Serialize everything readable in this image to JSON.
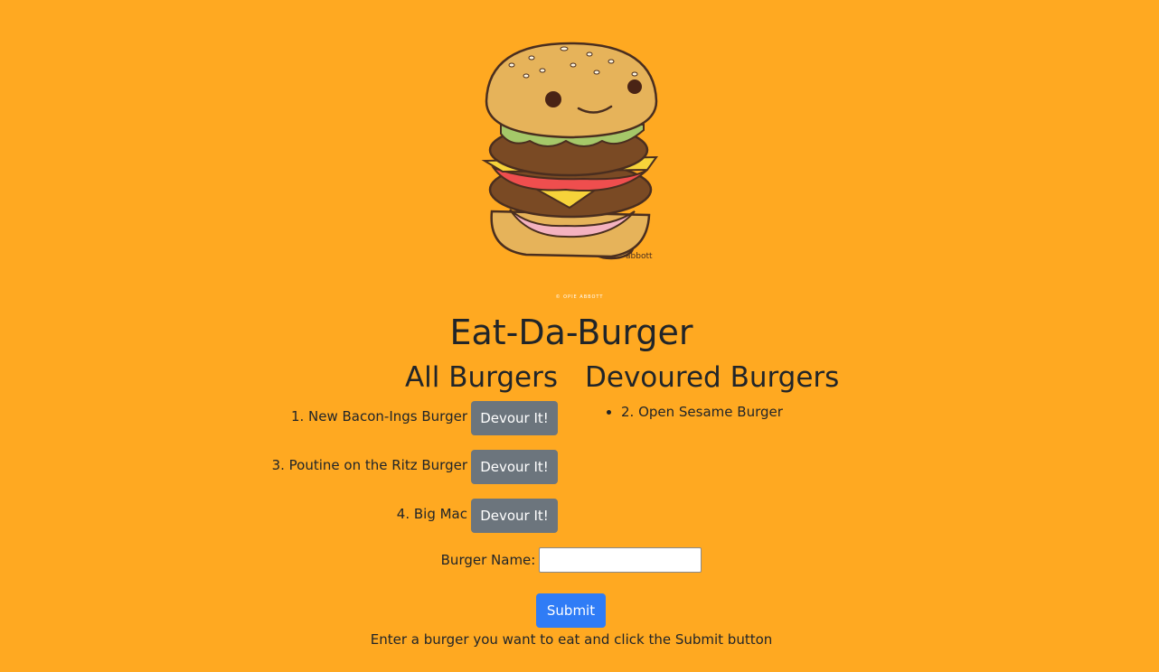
{
  "page": {
    "title": "Eat-Da-Burger",
    "credit": "© OPIE ABBOTT",
    "signature": "abbott"
  },
  "all_burgers": {
    "heading": "All Burgers",
    "items": [
      {
        "label": "1. New Bacon-Ings Burger",
        "button": "Devour It!"
      },
      {
        "label": "3. Poutine on the Ritz Burger",
        "button": "Devour It!"
      },
      {
        "label": "4. Big Mac",
        "button": "Devour It!"
      }
    ]
  },
  "devoured_burgers": {
    "heading": "Devoured Burgers",
    "items": [
      {
        "label": "2. Open Sesame Burger"
      }
    ]
  },
  "form": {
    "label": "Burger Name:",
    "input_value": "",
    "submit_label": "Submit",
    "hint": "Enter a burger you want to eat and click the Submit button"
  },
  "colors": {
    "background": "#FFA921",
    "devour_button": "#6c757d",
    "submit_button": "#2f7cf6"
  },
  "icons": {
    "hero": "cartoon-burger-mascot"
  }
}
